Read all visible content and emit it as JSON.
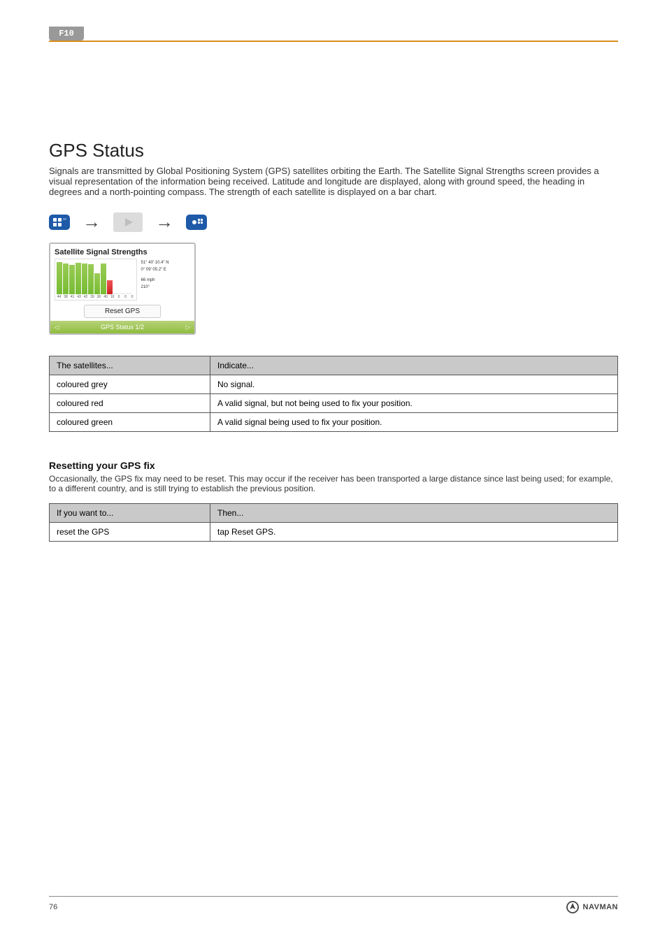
{
  "page": {
    "device_tag": "F10",
    "number": "76"
  },
  "section": {
    "title": "GPS Status",
    "intro": "Signals are transmitted by Global Positioning System (GPS) satellites orbiting the Earth. The Satellite Signal Strengths screen provides a visual representation of the information being received. Latitude and longitude are displayed, along with ground speed, the heading in degrees and a north-pointing compass. The strength of each satellite is displayed on a bar chart."
  },
  "screenshot": {
    "title": "Satellite Signal Strengths",
    "side": {
      "lat": "51° 40' 10.4\" N",
      "lon": "  0° 09' 05.2\" E",
      "speed": "66 mph",
      "heading": "210°"
    },
    "x_labels": [
      "44",
      "38",
      "41",
      "43",
      "42",
      "39",
      "30",
      "40",
      "19",
      "0",
      "0",
      "0"
    ],
    "reset_label": "Reset GPS",
    "footer_label": "GPS Status 1/2"
  },
  "table1": {
    "headers": [
      "The satellites...",
      "Indicate..."
    ],
    "rows": [
      [
        "coloured grey",
        "No signal."
      ],
      [
        "coloured red",
        "A valid signal, but not being used to fix your position."
      ],
      [
        "coloured green",
        "A valid signal being used to fix your position."
      ]
    ]
  },
  "reset_block": {
    "heading": "Resetting your GPS fix",
    "body": "Occasionally, the GPS fix may need to be reset. This may occur if the receiver has been transported a large distance since last being used; for example, to a different country, and is still trying to establish the previous position."
  },
  "table2": {
    "headers": [
      "If you want to...",
      "Then..."
    ],
    "rows": [
      [
        "reset the GPS",
        "tap Reset GPS."
      ]
    ]
  },
  "brand": "NAVMAN"
}
